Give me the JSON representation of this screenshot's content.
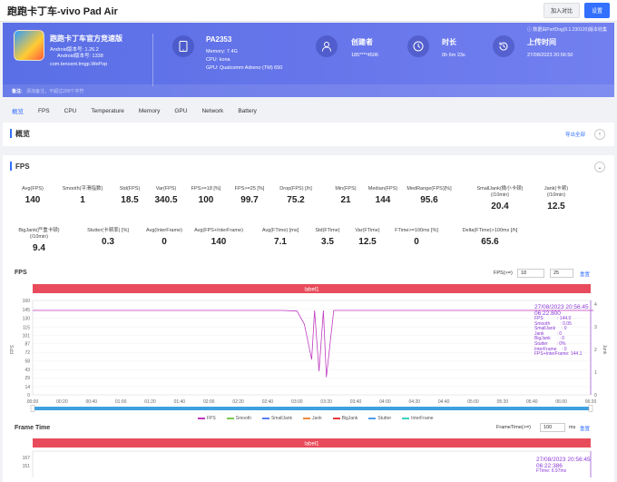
{
  "window": {
    "title": "跑跑卡丁车-vivo Pad Air",
    "compare_btn": "加入对比",
    "settings_btn": "设置"
  },
  "hero": {
    "note": "ⓘ 数据由PerfDog(9.1.230120)版本收集",
    "app_name": "跑跑卡丁车官方竞速版",
    "android_ver": "Android版本号: 1.26.2",
    "android_code": "Android版本号: 1338",
    "package": "com.tencent.tmgp.WePop",
    "device": "PA2353",
    "memory": "Memory: 7.4G",
    "cpu": "CPU: kona",
    "gpu": "GPU: Qualcomm Adreno (TM) 650",
    "creator_label": "创建者",
    "creator_value": "185****4506",
    "duration_label": "时长",
    "duration_value": "0h 6m 23s",
    "upload_label": "上传时间",
    "upload_value": "27/08/2023 20:56:50",
    "remark_label": "备注:",
    "remark_placeholder": "添加备注，不超过200个字符"
  },
  "tabs": [
    "概览",
    "FPS",
    "CPU",
    "Temperature",
    "Memory",
    "GPU",
    "Network",
    "Battery"
  ],
  "overview": {
    "title": "概览",
    "export": "导出全部"
  },
  "fps_section": {
    "title": "FPS",
    "stats_row1": [
      {
        "label": "Avg(FPS)",
        "value": "140"
      },
      {
        "label": "Smooth(平滑指数)",
        "value": "1"
      },
      {
        "label": "Std(FPS)",
        "value": "18.5"
      },
      {
        "label": "Var(FPS)",
        "value": "340.5"
      },
      {
        "label": "FPS>=18 [%]",
        "value": "100"
      },
      {
        "label": "FPS>=25 [%]",
        "value": "99.7"
      },
      {
        "label": "Drop(FPS) [/h]",
        "value": "75.2"
      },
      {
        "label": "Min(FPS)",
        "value": "21"
      },
      {
        "label": "Median(FPS)",
        "value": "144"
      },
      {
        "label": "MedRange(FPS)[%]",
        "value": "95.6"
      },
      {
        "label": "SmallJank(微小卡顿)\n(/10min)",
        "value": "20.4"
      },
      {
        "label": "Jank(卡顿)\n(/10min)",
        "value": "12.5"
      }
    ],
    "stats_row2": [
      {
        "label": "BigJank(严重卡顿)\n(/10min)",
        "value": "9.4"
      },
      {
        "label": "Stutter(卡顿率) [%]",
        "value": "0.3"
      },
      {
        "label": "Avg(InterFrame)",
        "value": "0"
      },
      {
        "label": "Avg(FPS+InterFrame)",
        "value": "140"
      },
      {
        "label": "Avg(FTime) [ms]",
        "value": "7.1"
      },
      {
        "label": "Std(FTime)",
        "value": "3.5"
      },
      {
        "label": "Var(FTime)",
        "value": "12.5"
      },
      {
        "label": "FTime>=100ms [%]",
        "value": "0"
      },
      {
        "label": "Delta(FTime)>100ms [/h]",
        "value": "65.6"
      }
    ]
  },
  "fps_chart_ui": {
    "title": "FPS",
    "ctrl_label": "FPS(>=)",
    "v1": "18",
    "v2": "25",
    "reset": "重置",
    "label_bar": "label1"
  },
  "ftime_chart_ui": {
    "title": "Frame Time",
    "ctrl_label": "FrameTime(>=)",
    "v1": "100",
    "unit": "ms",
    "reset": "重置",
    "label_bar": "label1"
  },
  "tooltip": {
    "date": "27/08/2023 20:56:45",
    "time": "06:22:800",
    "rows": [
      "FPS           : 144.0",
      "Smooth        : 0.05",
      "SmallJank     : 0",
      "Jank          : 0",
      "BigJank       : 0",
      "Stutter       : 0%",
      "InterFrame    : 0",
      "FPS+InterFrame: 144.1"
    ]
  },
  "tooltip2": {
    "date": "27/08/2023 20:56:45",
    "time": "06:22:386",
    "row": "FTime: 6.97ms"
  },
  "colors": {
    "fps": "#c03ac0",
    "smooth": "#7ec850",
    "smalljank": "#5a7cf0",
    "jank": "#f08a3a",
    "bigjank": "#e83a3a",
    "stutter": "#4aa0e8",
    "interframe": "#3ad0c0",
    "label_bar": "#e84c5c",
    "accent": "#3370ff"
  },
  "chart_data": [
    {
      "type": "line",
      "title": "FPS",
      "x_ticks": [
        "00:00",
        "00:20",
        "00:40",
        "01:00",
        "01:20",
        "01:40",
        "02:00",
        "02:20",
        "02:40",
        "03:00",
        "03:20",
        "03:40",
        "04:00",
        "04:20",
        "04:40",
        "05:00",
        "05:20",
        "05:40",
        "06:00",
        "06:20"
      ],
      "y_ticks": [
        0,
        14,
        29,
        43,
        58,
        72,
        87,
        101,
        115,
        130,
        145,
        160
      ],
      "y2_ticks": [
        0,
        1,
        2,
        3,
        4
      ],
      "ylabel": "FPS",
      "y2label": "Jank",
      "ylim": [
        0,
        160
      ],
      "series": [
        {
          "name": "FPS",
          "x": [
            "00:00",
            "02:50",
            "03:00",
            "03:05",
            "03:10",
            "03:12",
            "03:15",
            "03:18",
            "03:20",
            "03:25",
            "06:22"
          ],
          "values": [
            143,
            143,
            142,
            120,
            60,
            143,
            40,
            143,
            30,
            143,
            143
          ]
        },
        {
          "name": "Smooth",
          "values": []
        },
        {
          "name": "SmallJank",
          "values": []
        },
        {
          "name": "Jank",
          "values": []
        },
        {
          "name": "BigJank",
          "values": []
        },
        {
          "name": "Stutter",
          "values": []
        },
        {
          "name": "InterFrame",
          "values": []
        }
      ]
    },
    {
      "type": "line",
      "title": "Frame Time",
      "y_ticks": [
        151,
        167
      ],
      "series": [
        {
          "name": "FTime",
          "values": []
        }
      ]
    }
  ]
}
